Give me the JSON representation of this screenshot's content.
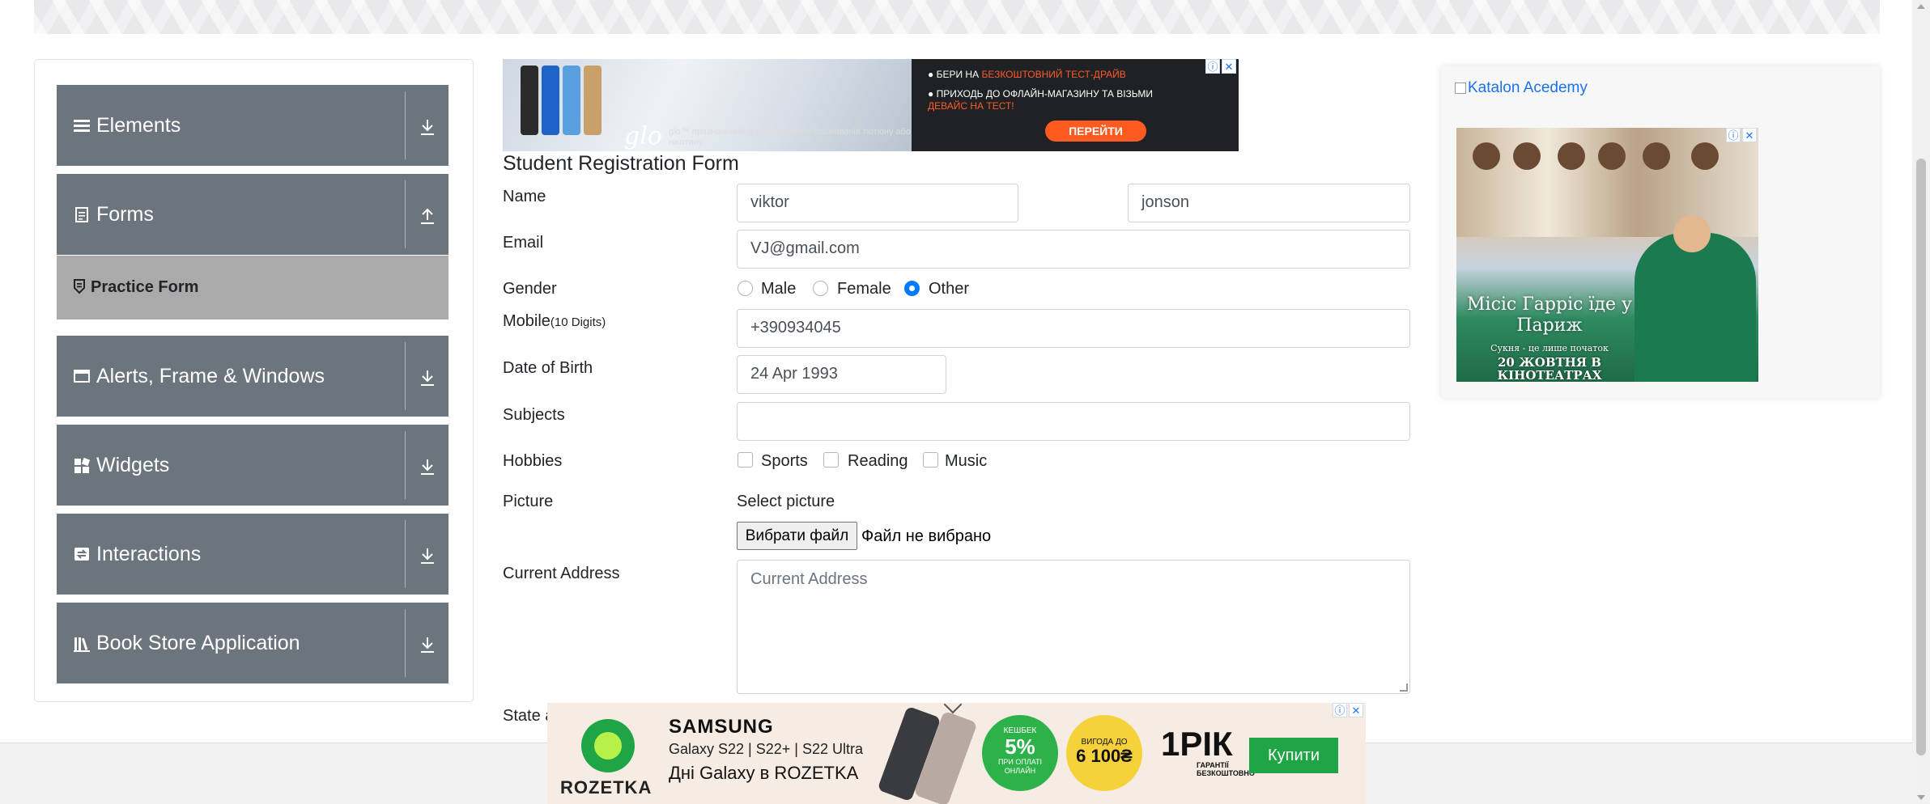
{
  "sidebar": {
    "groups": [
      {
        "label": "Elements",
        "icon": "hamburger-icon",
        "expanded": false
      },
      {
        "label": "Forms",
        "icon": "document-icon",
        "expanded": true
      },
      {
        "label": "Alerts, Frame & Windows",
        "icon": "window-icon",
        "expanded": false
      },
      {
        "label": "Widgets",
        "icon": "widgets-icon",
        "expanded": false
      },
      {
        "label": "Interactions",
        "icon": "interactions-icon",
        "expanded": false
      },
      {
        "label": "Book Store Application",
        "icon": "books-icon",
        "expanded": false
      }
    ],
    "active_item": {
      "label": "Practice Form",
      "icon": "badge-icon"
    },
    "colors": {
      "group_bg": "#6c757d",
      "active_bg": "#aaaaaa"
    }
  },
  "ad_top": {
    "line1_prefix": "БЕРИ НА",
    "line1_highlight": "БЕЗКОШТОВНИЙ ТЕСТ-ДРАЙВ",
    "line2": "ПРИХОДЬ ДО ОФЛАЙН-МАГАЗИНУ ТА ВІЗЬМИ",
    "line2_highlight": "ДЕВАЙС НА ТЕСТ!",
    "brand": "glo",
    "disclaimer": "glo™ призначений для повнолітніх споживачів тютюну або нікотину.",
    "cta": "ПЕРЕЙТИ"
  },
  "form": {
    "title": "Student Registration Form",
    "name_label": "Name",
    "first_name_value": "viktor",
    "last_name_value": "jonson",
    "email_label": "Email",
    "email_value": "VJ@gmail.com",
    "gender_label": "Gender",
    "gender_options": [
      "Male",
      "Female",
      "Other"
    ],
    "gender_selected": "Other",
    "mobile_label": "Mobile",
    "mobile_hint": "(10 Digits)",
    "mobile_value": "+390934045",
    "dob_label": "Date of Birth",
    "dob_value": "24 Apr 1993",
    "subjects_label": "Subjects",
    "subjects_value": "",
    "hobbies_label": "Hobbies",
    "hobbies_options": [
      "Sports",
      "Reading",
      "Music"
    ],
    "hobbies_checked": [],
    "picture_label": "Picture",
    "picture_hint": "Select picture",
    "file_button": "Вибрати файл",
    "file_status": "Файл не вибрано",
    "address_label": "Current Address",
    "address_placeholder": "Current Address",
    "state_label_partial": "State a"
  },
  "right_ad": {
    "katalon_alt": "Katalon Acedemy",
    "poster_title": "Місіс Гарріс їде у Париж",
    "poster_tagline": "Сукня - це лише початок",
    "poster_date": "20 ЖОВТНЯ В КІНОТЕАТРАХ"
  },
  "bottom_ad": {
    "store": "ROZETKA",
    "brand": "SAMSUNG",
    "models": "Galaxy S22 | S22+ | S22 Ultra",
    "days": "Дні Galaxy в ROZETKA",
    "cashback_label": "КЕШБЕК",
    "cashback_value": "5%",
    "cashback_note": "ПРИ ОПЛАТІ ОНЛАЙН",
    "benefit_label": "ВИГОДА ДО",
    "benefit_value": "6 100₴",
    "warranty_value": "1РІК",
    "warranty_note": "ГАРАНТІЇ БЕЗКОШТОВНО",
    "cta": "Купити"
  },
  "ad_controls": {
    "info": "ⓘ",
    "close": "✕"
  }
}
